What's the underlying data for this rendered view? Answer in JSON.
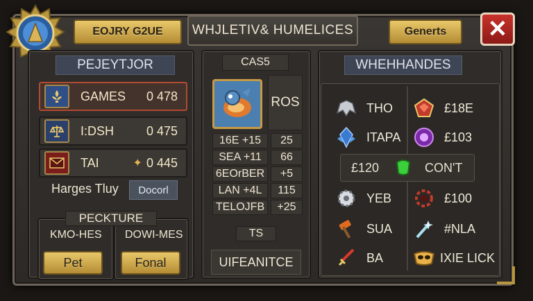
{
  "header": {
    "left_pill": "EOJRY G2UE",
    "title": "WHJLETIV& HUMELICES",
    "right_pill": "Generts",
    "close_symbol": "✕"
  },
  "left_panel": {
    "title": "PEJEYTJOR",
    "rows": [
      {
        "name": "GAMES",
        "value": "0 478",
        "icon": "fleur-icon",
        "active": true
      },
      {
        "name": "I:DSH",
        "value": "0 475",
        "icon": "scales-icon",
        "active": false
      },
      {
        "name": "TAI",
        "value": "0 445",
        "icon": "envelope-icon",
        "active": false,
        "star": "✦"
      }
    ],
    "footer_label": "Harges Tluy",
    "footer_button": "Docorl",
    "picture_title": "PECKTURE",
    "col_labels": [
      "KMO-HES",
      "DOWI-MES"
    ],
    "buttons": [
      "Pet",
      "Fonal"
    ]
  },
  "middle_panel": {
    "title": "CAS5",
    "side_label": "ROS",
    "stats": [
      {
        "label": "16E +15",
        "value": "25"
      },
      {
        "label": "SEA +11",
        "value": "66"
      },
      {
        "label": "6EOrBER",
        "value": "+5"
      },
      {
        "label": "LAN +4L",
        "value": "115"
      },
      {
        "label": "TELOJFB",
        "value": "+25"
      }
    ],
    "footer_tag": "TS",
    "footer_button": "UIFEANITCE"
  },
  "right_panel": {
    "title": "WHEHHANDES",
    "items": [
      {
        "icon": "helm-icon",
        "label": "THO"
      },
      {
        "icon": "red-gem-icon",
        "label": "£18E"
      },
      {
        "icon": "blue-crystal-icon",
        "label": "ITAPA"
      },
      {
        "icon": "purple-orb-icon",
        "label": "£103"
      },
      {
        "icon": "gear-icon",
        "label": "YEB"
      },
      {
        "icon": "red-cog-icon",
        "label": "£100"
      },
      {
        "icon": "hammer-icon",
        "label": "SUA"
      },
      {
        "icon": "wand-icon",
        "label": "#NLA"
      },
      {
        "icon": "sword-icon",
        "label": "BA"
      },
      {
        "icon": "mask-icon",
        "label": "IXIE LICK"
      }
    ],
    "center_row": {
      "left": "£120",
      "icon": "green-gem-icon",
      "right": "CON'T"
    }
  },
  "colors": {
    "gold": "#d9b558",
    "close_red": "#b72a24",
    "panel_head_blue": "#3e4554",
    "frame": "#6b6358"
  }
}
